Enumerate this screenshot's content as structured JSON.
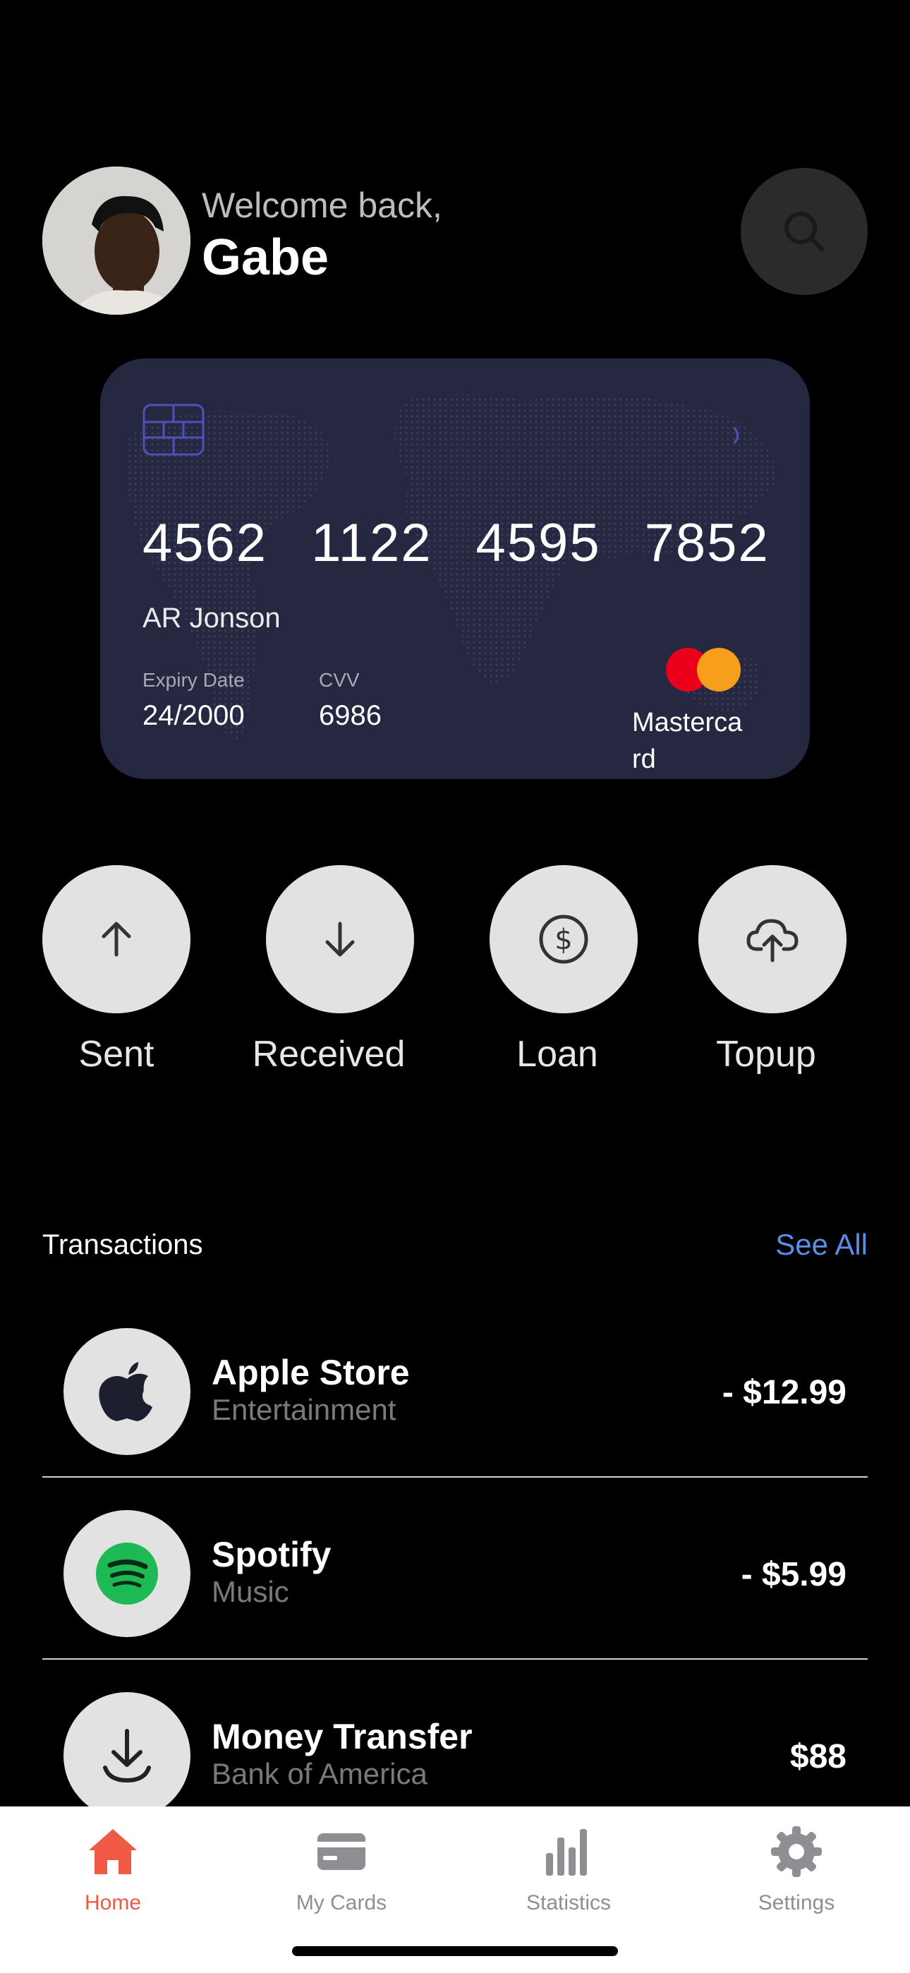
{
  "header": {
    "welcome_text": "Welcome back,",
    "user_name": "Gabe",
    "search_icon": "search-icon"
  },
  "card": {
    "number_groups": [
      "4562",
      "1122",
      "4595",
      "7852"
    ],
    "holder_name": "AR Jonson",
    "expiry_label": "Expiry Date",
    "expiry_value": "24/2000",
    "cvv_label": "CVV",
    "cvv_value": "6986",
    "brand_label": "Mastercard",
    "background_color": "#262740"
  },
  "actions": [
    {
      "label": "Sent",
      "icon": "arrow-up-icon"
    },
    {
      "label": "Received",
      "icon": "arrow-down-icon"
    },
    {
      "label": "Loan",
      "icon": "dollar-circle-icon"
    },
    {
      "label": "Topup",
      "icon": "cloud-upload-icon"
    }
  ],
  "transactions": {
    "title": "Transactions",
    "see_all_label": "See All",
    "items": [
      {
        "name": "Apple Store",
        "category": "Entertainment",
        "amount": "- $12.99",
        "icon": "apple-icon"
      },
      {
        "name": "Spotify",
        "category": "Music",
        "amount": "- $5.99",
        "icon": "spotify-icon"
      },
      {
        "name": "Money Transfer",
        "category": "Bank of America",
        "amount": "$88",
        "icon": "download-icon"
      }
    ]
  },
  "tabbar": {
    "items": [
      {
        "label": "Home",
        "icon": "home-icon",
        "active": true
      },
      {
        "label": "My Cards",
        "icon": "card-icon",
        "active": false
      },
      {
        "label": "Statistics",
        "icon": "bar-chart-icon",
        "active": false
      },
      {
        "label": "Settings",
        "icon": "gear-icon",
        "active": false
      }
    ]
  },
  "colors": {
    "accent": "#f05a44",
    "link": "#5b8de6",
    "spotify_green": "#1db954",
    "mastercard_red": "#eb001b",
    "mastercard_orange": "#f79e1b"
  }
}
